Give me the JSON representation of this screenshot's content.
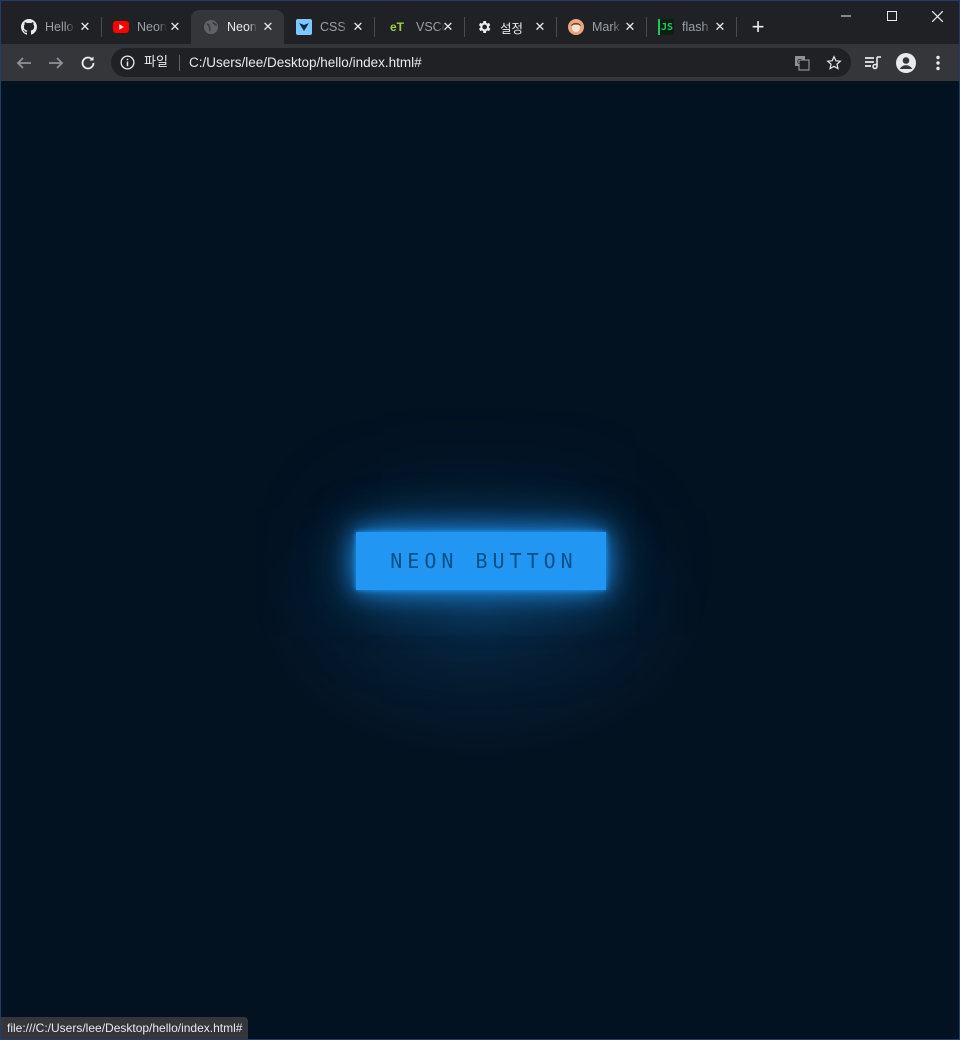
{
  "tabs": [
    {
      "title": "Hello",
      "icon": "github-icon",
      "active": false
    },
    {
      "title": "Neon",
      "icon": "youtube-icon",
      "active": false
    },
    {
      "title": "Neon",
      "icon": "globe-icon",
      "active": true
    },
    {
      "title": "CSS",
      "icon": "css-tricks-icon",
      "active": false
    },
    {
      "title": "VSCode",
      "icon": "et-icon",
      "favicon_text": "eT",
      "active": false
    },
    {
      "title": "설정",
      "icon": "settings-gear-icon",
      "active": false
    },
    {
      "title": "Mark",
      "icon": "avatar-icon",
      "active": false
    },
    {
      "title": "flash",
      "icon": "js-icon",
      "favicon_text": "JS",
      "active": false
    }
  ],
  "new_tab_label": "+",
  "close_glyph": "✕",
  "omnibox": {
    "security_chip": "파일",
    "url": "C:/Users/lee/Desktop/hello/index.html#"
  },
  "page": {
    "button_label": "NEON BUTTON",
    "accent_color": "#2196f3",
    "background_color": "#031221"
  },
  "status_bar": {
    "text": "file:///C:/Users/lee/Desktop/hello/index.html#"
  }
}
